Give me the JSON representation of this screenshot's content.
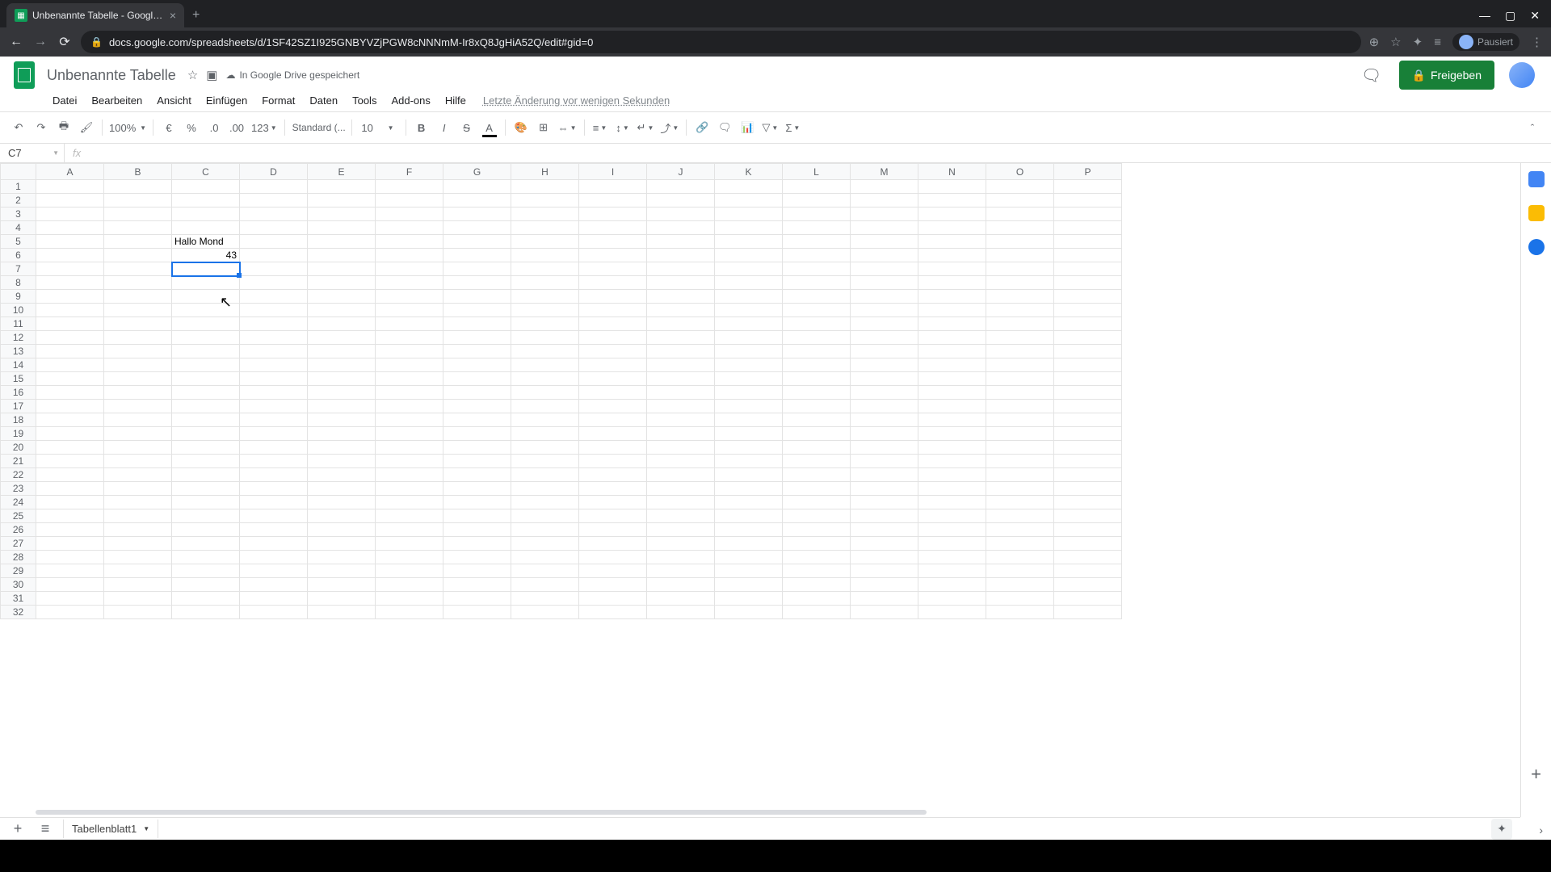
{
  "browser": {
    "tab_title": "Unbenannte Tabelle - Google Ta",
    "url": "docs.google.com/spreadsheets/d/1SF42SZ1I925GNBYVZjPGW8cNNNmM-Ir8xQ8JgHiA52Q/edit#gid=0",
    "profile_status": "Pausiert"
  },
  "doc": {
    "title": "Unbenannte Tabelle",
    "drive_status": "In Google Drive gespeichert",
    "share_label": "Freigeben",
    "last_edit": "Letzte Änderung vor wenigen Sekunden"
  },
  "menu": [
    "Datei",
    "Bearbeiten",
    "Ansicht",
    "Einfügen",
    "Format",
    "Daten",
    "Tools",
    "Add-ons",
    "Hilfe"
  ],
  "toolbar": {
    "zoom": "100%",
    "currency": "€",
    "percent": "%",
    "dec_less": ".0",
    "dec_more": ".00",
    "numfmt": "123",
    "font": "Standard (...",
    "font_size": "10"
  },
  "formula": {
    "cell_ref": "C7",
    "fx": "fx",
    "value": ""
  },
  "columns": [
    "A",
    "B",
    "C",
    "D",
    "E",
    "F",
    "G",
    "H",
    "I",
    "J",
    "K",
    "L",
    "M",
    "N",
    "O",
    "P"
  ],
  "row_count": 32,
  "selected": {
    "row": 7,
    "col": "C"
  },
  "cells": {
    "C5": {
      "value": "Hallo Mond",
      "type": "text"
    },
    "C6": {
      "value": "43",
      "type": "number"
    }
  },
  "sheet_tab": "Tabellenblatt1"
}
